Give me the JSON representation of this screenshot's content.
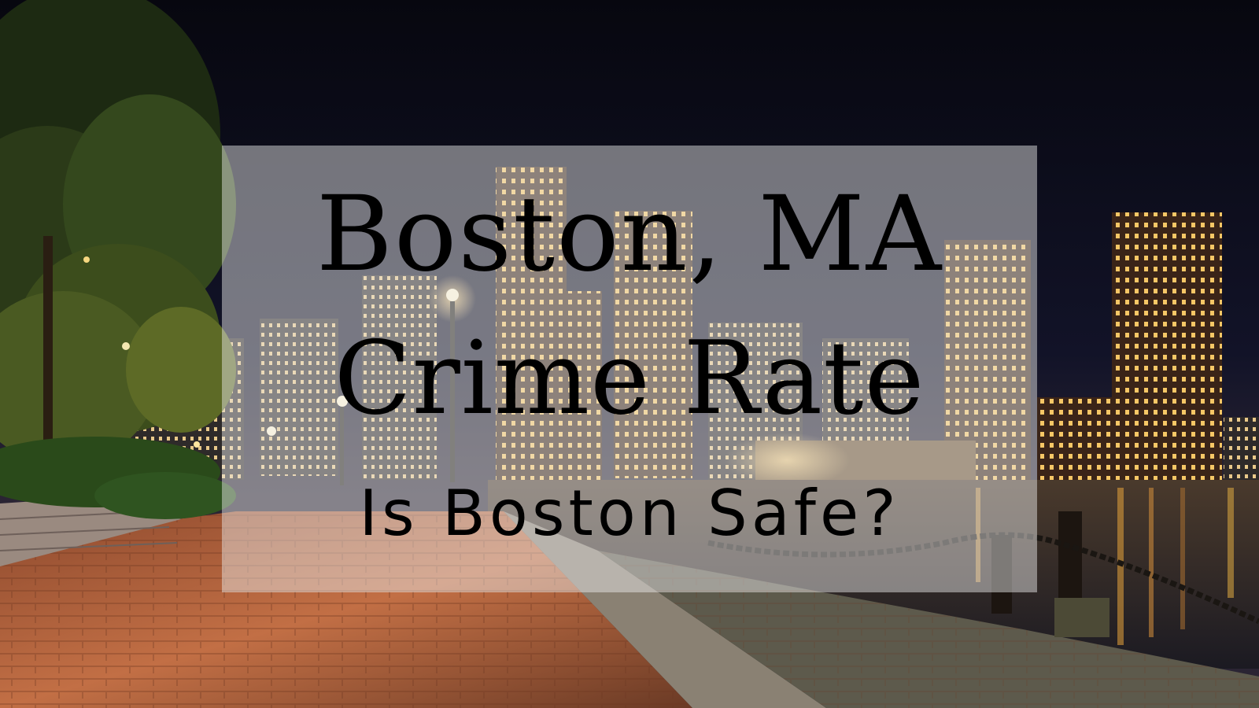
{
  "title": {
    "line1": "Boston, MA",
    "line2": "Crime Rate",
    "subtitle": "Is Boston Safe?"
  },
  "colors": {
    "sky": "#0d0d1c",
    "overlay": "#ebebeb",
    "text": "#000000",
    "window_light": "#f6c766",
    "walkway": "#b8603a"
  }
}
